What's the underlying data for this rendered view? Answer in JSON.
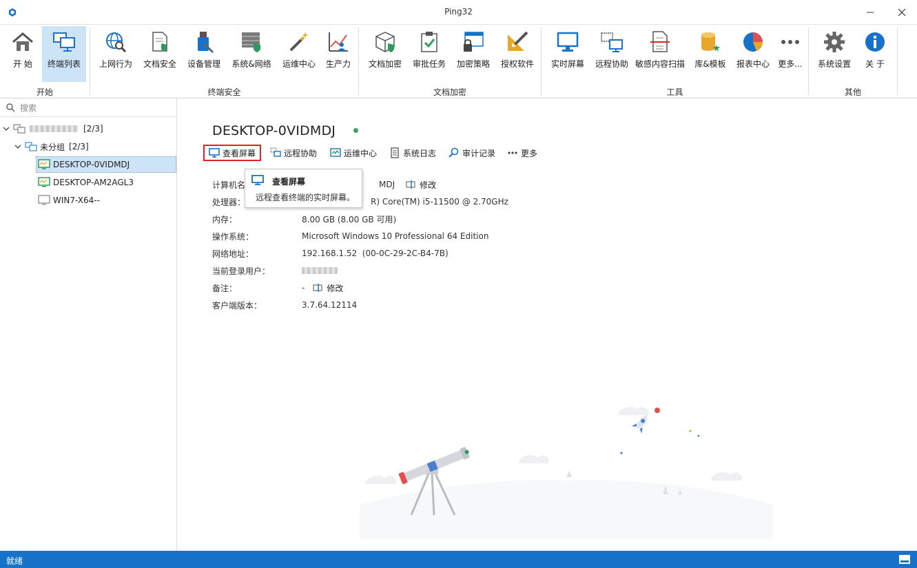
{
  "window": {
    "title": "Ping32"
  },
  "ribbon": {
    "groups": [
      {
        "label": "开始",
        "items": [
          {
            "label": "开 始",
            "icon": "home-icon"
          },
          {
            "label": "终端列表",
            "icon": "terminal-list-icon",
            "active": true
          }
        ]
      },
      {
        "label": "终端安全",
        "items": [
          {
            "label": "上网行为",
            "icon": "web-behavior-icon"
          },
          {
            "label": "文档安全",
            "icon": "doc-security-icon"
          },
          {
            "label": "设备管理",
            "icon": "device-manage-icon"
          },
          {
            "label": "系统&网络",
            "icon": "system-network-icon"
          },
          {
            "label": "运维中心",
            "icon": "ops-wand-icon"
          },
          {
            "label": "生产力",
            "icon": "productivity-chart-icon"
          }
        ]
      },
      {
        "label": "文档加密",
        "items": [
          {
            "label": "文档加密",
            "icon": "doc-encrypt-box-icon"
          },
          {
            "label": "审批任务",
            "icon": "approval-clipboard-icon"
          },
          {
            "label": "加密策略",
            "icon": "encrypt-policy-icon"
          },
          {
            "label": "授权软件",
            "icon": "authorize-software-icon"
          }
        ]
      },
      {
        "label": "工具",
        "items": [
          {
            "label": "实时屏幕",
            "icon": "realtime-screen-icon"
          },
          {
            "label": "远程协助",
            "icon": "remote-assist-icon"
          },
          {
            "label": "敏感内容扫描",
            "icon": "sensitive-scan-icon"
          },
          {
            "label": "库&模板",
            "icon": "library-template-icon"
          },
          {
            "label": "报表中心",
            "icon": "report-pie-icon"
          },
          {
            "label": "更多...",
            "icon": "more-dots-icon"
          }
        ]
      },
      {
        "label": "其他",
        "items": [
          {
            "label": "系统设置",
            "icon": "settings-gear-icon"
          },
          {
            "label": "关 于",
            "icon": "about-info-icon"
          }
        ]
      }
    ]
  },
  "sidebar": {
    "search_placeholder": "搜索",
    "root": {
      "count": "[2/3]"
    },
    "group": {
      "label": "未分组",
      "count": "[2/3]"
    },
    "devices": [
      {
        "label": "DESKTOP-0VIDMDJ",
        "status": "online",
        "selected": true
      },
      {
        "label": "DESKTOP-AM2AGL3",
        "status": "online",
        "selected": false
      },
      {
        "label": "WIN7-X64--",
        "status": "offline",
        "selected": false
      }
    ]
  },
  "detail": {
    "hostname": "DESKTOP-0VIDMDJ",
    "status_color": "#3aa55a",
    "toolbar": [
      {
        "label": "查看屏幕",
        "icon": "view-screen-icon"
      },
      {
        "label": "远程协助",
        "icon": "remote-assist-small-icon"
      },
      {
        "label": "运维中心",
        "icon": "ops-center-small-icon"
      },
      {
        "label": "系统日志",
        "icon": "system-log-icon"
      },
      {
        "label": "审计记录",
        "icon": "audit-search-icon"
      },
      {
        "label": "更多",
        "icon": "more-dots-small-icon"
      }
    ],
    "info": [
      {
        "key": "计算机名",
        "value": "MDJ",
        "modify": "修改"
      },
      {
        "key": "处理器：",
        "value": "R) Core(TM) i5-11500 @ 2.70GHz"
      },
      {
        "key": "内存：",
        "value": "8.00 GB (8.00 GB 可用)"
      },
      {
        "key": "操作系统：",
        "value": "Microsoft Windows 10 Professional 64 Edition"
      },
      {
        "key": "网络地址：",
        "value": "192.168.1.52  (00-0C-29-2C-B4-7B)"
      },
      {
        "key": "当前登录用户：",
        "value": ""
      },
      {
        "key": "备注：",
        "value": "-",
        "modify": "修改"
      },
      {
        "key": "客户端版本：",
        "value": "3.7.64.12114"
      }
    ],
    "tooltip": {
      "title": "查看屏幕",
      "desc": "远程查看终端的实时屏幕。"
    }
  },
  "statusbar": {
    "text": "就绪"
  },
  "colors": {
    "accent": "#1773c9",
    "highlight_border": "#e02424",
    "selection": "#cde3f6"
  }
}
